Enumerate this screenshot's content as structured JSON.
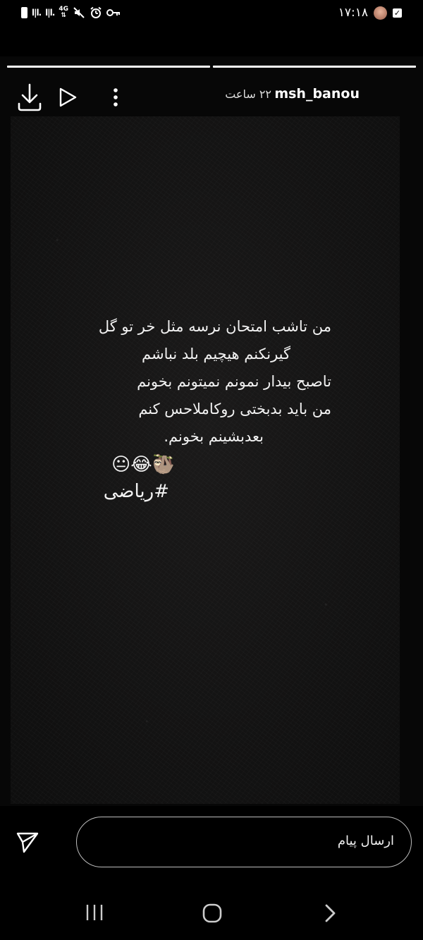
{
  "status_bar": {
    "time": "۱۷:۱۸",
    "signal_1": "l|l.",
    "signal_2": "l|l.",
    "network_type": "4G",
    "icons": [
      "battery-icon",
      "signal-icon",
      "signal-icon",
      "network-4g-icon",
      "mute-icon",
      "alarm-icon",
      "key-icon",
      "check-notification-icon",
      "avatar-notification-icon"
    ]
  },
  "story": {
    "segments": [
      {
        "progress": 1.0
      },
      {
        "progress": 1.0
      }
    ],
    "username": "msh_banou",
    "timestamp": "۲۲ ساعت",
    "header_icons": [
      "download-icon",
      "play-icon",
      "more-vertical-icon"
    ],
    "text_lines": [
      "من تاشب امتحان نرسه مثل خر تو گل",
      "گیرنکنم هیچیم بلد نباشم",
      "تاصبح بیدار نمونم نمیتونم بخونم",
      "من باید بدبختی روکاملا‌حس کنم",
      "بعدبشینم بخونم."
    ],
    "emojis": "🦥😂😐",
    "hashtag": "#ریاضی"
  },
  "reply": {
    "placeholder": "ارسال پیام",
    "send_icon": "send-icon"
  },
  "nav_bar": {
    "buttons": [
      "recent-apps-icon",
      "home-icon",
      "back-icon"
    ]
  }
}
